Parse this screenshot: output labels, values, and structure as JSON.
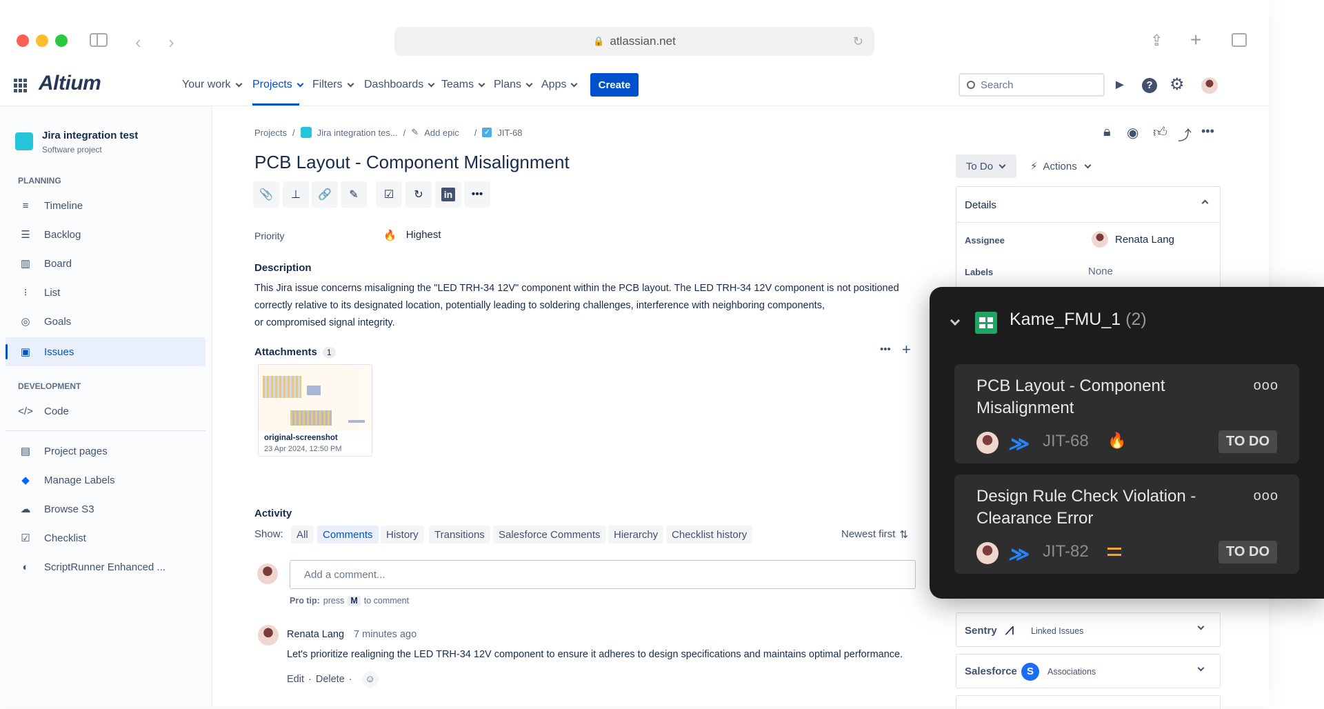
{
  "browser": {
    "url": "atlassian.net"
  },
  "app": {
    "logo": "Altium",
    "create_label": "Create",
    "search_placeholder": "Search"
  },
  "topnav": {
    "items": [
      "Your work",
      "Projects",
      "Filters",
      "Dashboards",
      "Teams",
      "Plans",
      "Apps"
    ]
  },
  "sidebar": {
    "project_name": "Jira integration test",
    "project_type": "Software project",
    "planning_heading": "PLANNING",
    "planning_items": [
      "Timeline",
      "Backlog",
      "Board",
      "List",
      "Goals",
      "Issues"
    ],
    "development_heading": "DEVELOPMENT",
    "dev_items": [
      "Code"
    ],
    "extra_items": [
      "Project pages",
      "Manage Labels",
      "Browse S3",
      "Checklist",
      "ScriptRunner Enhanced ..."
    ]
  },
  "breadcrumb": {
    "projects": "Projects",
    "project": "Jira integration tes...",
    "epic": "Add epic",
    "issue": "JIT-68",
    "sep": "/"
  },
  "issue": {
    "title": "PCB Layout - Component Misalignment",
    "priority_label": "Priority",
    "priority_value": "Highest",
    "description_heading": "Description",
    "description_line1": "This Jira issue concerns misaligning the \"LED TRH-34 12V\" component within the PCB layout. The LED TRH-34 12V component is not positioned",
    "description_line2": "correctly relative to its designated location, potentially leading to soldering challenges, interference with neighboring components,",
    "description_line3": "or compromised signal integrity.",
    "attachments_heading": "Attachments",
    "attachments_count": "1",
    "attachment_name": "original-screenshot",
    "attachment_date": "23 Apr 2024, 12:50 PM"
  },
  "activity": {
    "heading": "Activity",
    "show_label": "Show:",
    "filters": [
      "All",
      "Comments",
      "History",
      "Transitions",
      "Salesforce Comments",
      "Hierarchy",
      "Checklist history"
    ],
    "sort_label": "Newest first",
    "comment_placeholder": "Add a comment...",
    "protip_bold": "Pro tip:",
    "protip_press": "press",
    "protip_key": "M",
    "protip_rest": "to comment",
    "comment_author": "Renata Lang",
    "comment_time": "7 minutes ago",
    "comment_text": "Let's prioritize realigning the LED TRH-34 12V component to ensure it adheres to design specifications and maintains optimal performance.",
    "edit_label": "Edit",
    "delete_label": "Delete",
    "dot_sep": "·"
  },
  "right_panel": {
    "status": "To Do",
    "actions": "Actions",
    "details_heading": "Details",
    "assignee_label": "Assignee",
    "assignee_value": "Renata Lang",
    "labels_label": "Labels",
    "labels_value": "None",
    "sentry_label": "Sentry",
    "sentry_link": "Linked Issues",
    "salesforce_label": "Salesforce",
    "salesforce_link": "Associations"
  },
  "overlay": {
    "sheet_name": "Kame_FMU_1",
    "count": "(2)",
    "cards": [
      {
        "title": "PCB Layout - Component Misalignment",
        "key": "JIT-68",
        "status": "TO DO",
        "priority_icon": "fire-icon"
      },
      {
        "title": "Design Rule Check Violation - Clearance Error",
        "key": "JIT-82",
        "status": "TO DO",
        "priority_icon": "medium-priority-icon"
      }
    ]
  },
  "colors": {
    "brand_blue": "#0052cc",
    "selected_bg": "#e9f0fc",
    "overlay_bg": "#1c1c1c",
    "card_bg": "#2e2e2e",
    "medium_priority": "#f5a623"
  }
}
